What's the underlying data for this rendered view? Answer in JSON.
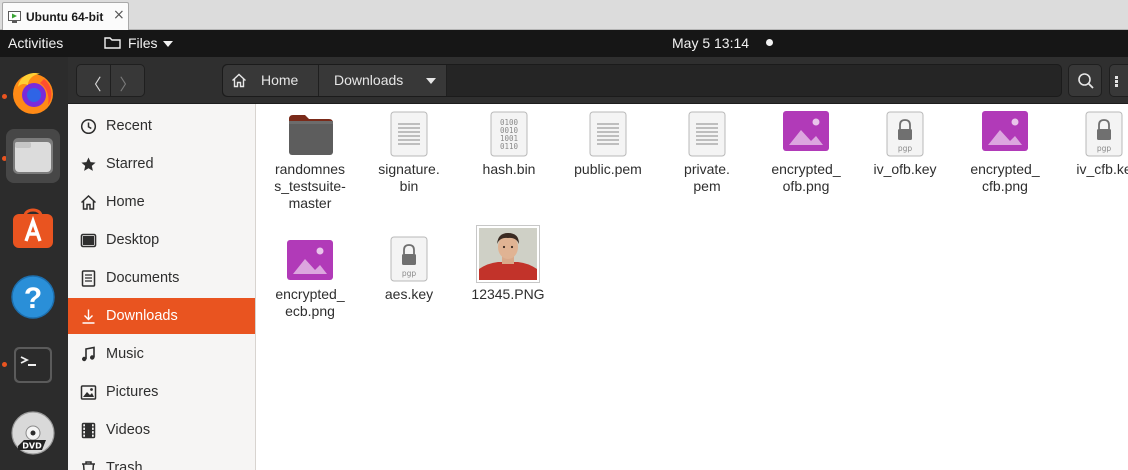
{
  "vm_tab": {
    "label": "Ubuntu 64-bit",
    "close": "×"
  },
  "topbar": {
    "activities": "Activities",
    "app_menu_label": "Files",
    "clock": "May 5  13:14"
  },
  "dock": {
    "items": [
      "firefox-icon",
      "files-icon",
      "software-center-icon",
      "help-icon",
      "terminal-icon",
      "dvd-icon"
    ],
    "accent": "#e95420"
  },
  "headerbar": {
    "back_glyph": "〈",
    "forward_glyph": "〉",
    "crumbs": [
      "Home",
      "Downloads"
    ]
  },
  "sidebar": {
    "items": [
      {
        "label": "Recent",
        "icon": "clock-icon"
      },
      {
        "label": "Starred",
        "icon": "star-icon"
      },
      {
        "label": "Home",
        "icon": "home-icon"
      },
      {
        "label": "Desktop",
        "icon": "desktop-icon"
      },
      {
        "label": "Documents",
        "icon": "document-icon"
      },
      {
        "label": "Downloads",
        "icon": "download-icon",
        "active": true
      },
      {
        "label": "Music",
        "icon": "music-icon"
      },
      {
        "label": "Pictures",
        "icon": "picture-icon"
      },
      {
        "label": "Videos",
        "icon": "video-icon"
      },
      {
        "label": "Trash",
        "icon": "trash-icon"
      }
    ]
  },
  "files": [
    {
      "name": "randomness_testsuite-master",
      "lines": [
        "randomnes",
        "s_testsuite-",
        "master"
      ],
      "type": "folder"
    },
    {
      "name": "signature.bin",
      "lines": [
        "signature.",
        "bin"
      ],
      "type": "text"
    },
    {
      "name": "hash.bin",
      "lines": [
        "hash.bin"
      ],
      "type": "binary",
      "glyph": "0100\n0010\n1001\n0110"
    },
    {
      "name": "public.pem",
      "lines": [
        "public.pem"
      ],
      "type": "text"
    },
    {
      "name": "private.pem",
      "lines": [
        "private.",
        "pem"
      ],
      "type": "text"
    },
    {
      "name": "encrypted_ofb.png",
      "lines": [
        "encrypted_",
        "ofb.png"
      ],
      "type": "image"
    },
    {
      "name": "iv_ofb.key",
      "lines": [
        "iv_ofb.key"
      ],
      "type": "pgp",
      "badge": "pgp"
    },
    {
      "name": "encrypted_cfb.png",
      "lines": [
        "encrypted_",
        "cfb.png"
      ],
      "type": "image"
    },
    {
      "name": "iv_cfb.key",
      "lines": [
        "iv_cfb.ke"
      ],
      "type": "pgp",
      "badge": "pgp"
    },
    {
      "name": "encrypted_ecb.png",
      "lines": [
        "encrypted_",
        "ecb.png"
      ],
      "type": "image"
    },
    {
      "name": "aes.key",
      "lines": [
        "aes.key"
      ],
      "type": "pgp",
      "badge": "pgp"
    },
    {
      "name": "12345.PNG",
      "lines": [
        "12345.PNG"
      ],
      "type": "photo"
    }
  ],
  "colors": {
    "accent": "#e95420",
    "image_icon": "#b13ab8",
    "folder": "#5d5d5d"
  }
}
